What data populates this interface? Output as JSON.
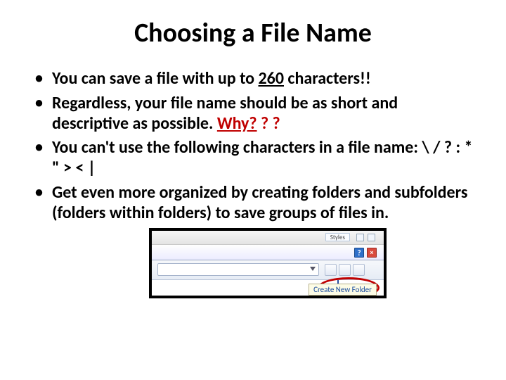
{
  "title": "Choosing a File Name",
  "bullets": {
    "b1": {
      "pre": "You can save a file with up to ",
      "num": "260",
      "post": " characters!!"
    },
    "b2": {
      "text": "Regardless, your file name should be as short and descriptive as possible.  ",
      "why": "Why?",
      "q": " ? ?"
    },
    "b3": {
      "pre": "You can't use the following characters in a file name:   ",
      "chars": "\\ / ? : * \" > < |"
    },
    "b4": {
      "text": "Get even more organized by creating folders and subfolders (folders within folders) to save groups of files in."
    }
  },
  "dialog": {
    "styles_label": "Styles",
    "help_glyph": "?",
    "close_glyph": "×",
    "tooltip": "Create New Folder"
  }
}
